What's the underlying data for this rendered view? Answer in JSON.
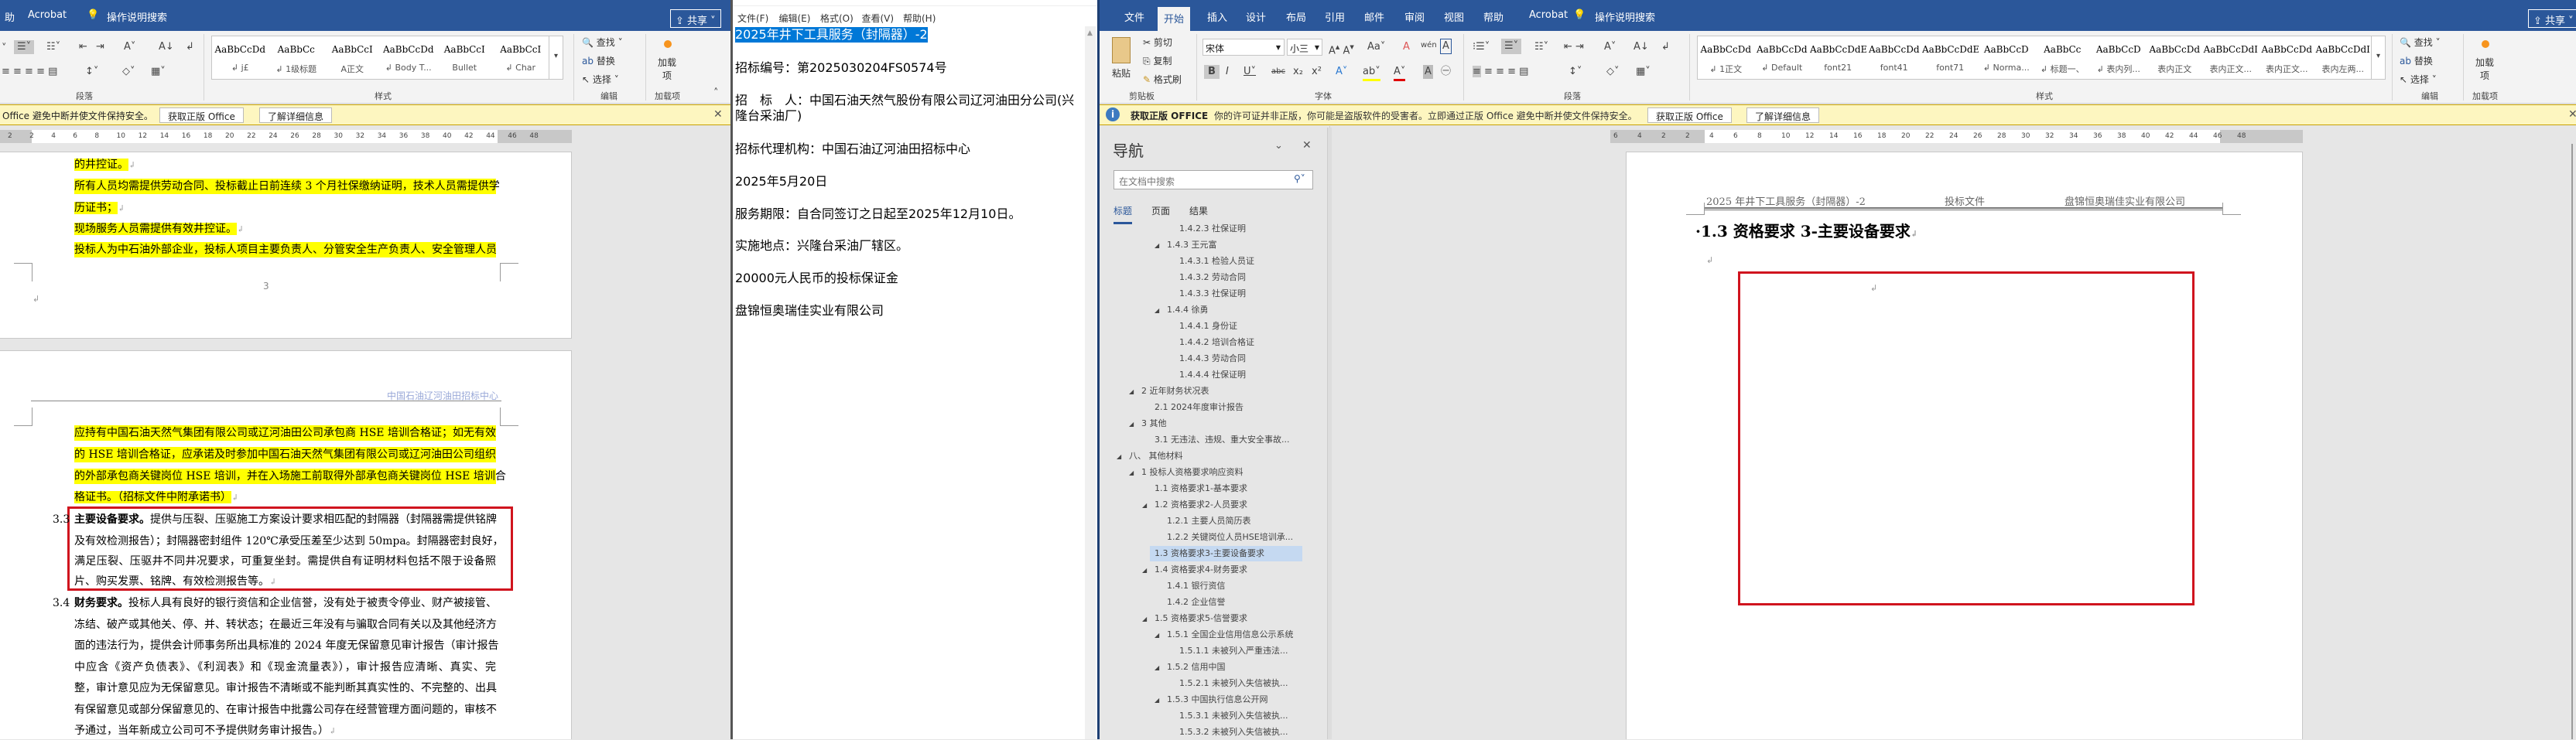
{
  "left_word": {
    "tabs": [
      "助",
      "Acrobat"
    ],
    "tell_me": "操作说明搜索",
    "share": "共享",
    "groups": {
      "paragraph": "段落",
      "styles": "样式",
      "editing": "编辑",
      "addins": "加载项"
    },
    "editing": {
      "find": "查找",
      "replace": "替换",
      "select": "选择"
    },
    "addins_button": "加载项",
    "styles": [
      {
        "preview": "AaBbCcDd",
        "name": "↲ j£"
      },
      {
        "preview": "AaBbCc",
        "name": "↲ 1级标题"
      },
      {
        "preview": "AaBbCcI",
        "name": "A正文"
      },
      {
        "preview": "AaBbCcDd",
        "name": "↲ Body T..."
      },
      {
        "preview": "AaBbCcI",
        "name": "Bullet"
      },
      {
        "preview": "AaBbCcI",
        "name": "↲ Char"
      }
    ],
    "message": "Office 避免中断并使文件保持安全。",
    "msg_btn_genuine": "获取正版 Office",
    "msg_btn_learn": "了解详细信息",
    "ruler_ticks": [
      "2",
      "2",
      "4",
      "6",
      "8",
      "10",
      "12",
      "14",
      "16",
      "18",
      "20",
      "22",
      "24",
      "26",
      "28",
      "30",
      "32",
      "34",
      "36",
      "38",
      "40",
      "42",
      "44",
      "46",
      "48"
    ],
    "page1_lines": [
      "的井控证。",
      "所有人员均需提供劳动合同、投标截止日前连续 3 个月社保缴纳证明，技术人员需提供学",
      "历证书；",
      "现场服务人员需提供有效井控证。",
      "投标人为中石油外部企业，投标人项目主要负责人、分管安全生产负责人、安全管理人员"
    ],
    "page_number": "3",
    "page2_header": "中国石油辽河油田招标中心",
    "page2_hl_lines": [
      "应持有中国石油天然气集团有限公司或辽河油田公司承包商 HSE 培训合格证；如无有效",
      "的 HSE 培训合格证，应承诺及时参加中国石油天然气集团有限公司或辽河油田公司组织",
      "的外部承包商关键岗位 HSE 培训，并在入场施工前取得外部承包商关键岗位 HSE 培训合",
      "格证书。（招标文件中附承诺书）"
    ],
    "item_33": {
      "number": "3.3",
      "title": "主要设备要求。",
      "lines": [
        "提供与压裂、压驱施工方案设计要求相匹配的封隔器（封隔器需提供铭牌",
        "及有效检测报告）；封隔器密封组件 120℃承受压差至少达到 50mpa。封隔器密封良好，",
        "满足压裂、压驱井不同井况要求，可重复坐封。需提供自有证明材料包括不限于设备照",
        "片、购买发票、铭牌、有效检测报告等。"
      ]
    },
    "item_34": {
      "number": "3.4",
      "title": "财务要求。",
      "lines": [
        "投标人具有良好的银行资信和企业信誉，没有处于被责令停业、财产被接管、",
        "冻结、破产或其他关、停、并、转状态；在最近三年没有与骗取合同有关以及其他经济方",
        "面的违法行为，提供会计师事务所出具标准的 2024 年度无保留意见审计报告（审计报告",
        "中应含《资产负债表》、《利润表》和《现金流量表》），审计报告应清晰、真实、完",
        "整，审计意见应为无保留意见。审计报告不清晰或不能判断其真实性的、不完整的、出具",
        "有保留意见或部分保留意见的、在审计报告中批露公司存在经营管理方面问题的，审核不",
        "予通过，当年新成立公司可不予提供财务审计报告。）"
      ]
    }
  },
  "notepad": {
    "menu": [
      "文件(F)",
      "编辑(E)",
      "格式(O)",
      "查看(V)",
      "帮助(H)"
    ],
    "lines": [
      "2025年井下工具服务（封隔器）-2",
      "招标编号：第2025030204FS0574号",
      "招　标　人：中国石油天然气股份有限公司辽河油田分公司(兴",
      "隆台采油厂)",
      "招标代理机构：中国石油辽河油田招标中心",
      "2025年5月20日",
      "服务期限：自合同签订之日起至2025年12月10日。",
      "实施地点：兴隆台采油厂辖区。",
      "20000元人民币的投标保证金",
      "盘锦恒奥瑞佳实业有限公司"
    ]
  },
  "right_word": {
    "tabs": [
      "文件",
      "开始",
      "插入",
      "设计",
      "布局",
      "引用",
      "邮件",
      "审阅",
      "视图",
      "帮助",
      "Acrobat"
    ],
    "active_tab": "开始",
    "tell_me": "操作说明搜索",
    "share": "共享",
    "clipboard": {
      "paste": "粘贴",
      "cut": "剪切",
      "copy": "复制",
      "format_painter": "格式刷"
    },
    "font_name": "宋体",
    "font_size": "小三",
    "groups": {
      "clipboard": "剪贴板",
      "font": "字体",
      "paragraph": "段落",
      "styles": "样式",
      "editing": "编辑",
      "addins": "加载项"
    },
    "editing": {
      "find": "查找",
      "replace": "替换",
      "select": "选择"
    },
    "addins_button": "加载项",
    "styles": [
      {
        "preview": "AaBbCcDd",
        "name": "↲ 1正文"
      },
      {
        "preview": "AaBbCcDd",
        "name": "↲ Default"
      },
      {
        "preview": "AaBbCcDdE",
        "name": "font21"
      },
      {
        "preview": "AaBbCcDd",
        "name": "font41"
      },
      {
        "preview": "AaBbCcDdEe",
        "name": "font71"
      },
      {
        "preview": "AaBbCcD",
        "name": "↲ Norma..."
      },
      {
        "preview": "AaBbCc",
        "name": "↲ 标题一、"
      },
      {
        "preview": "AaBbCcD",
        "name": "↲ 表内列..."
      },
      {
        "preview": "AaBbCcDd",
        "name": "表内正文"
      },
      {
        "preview": "AaBbCcDdI",
        "name": "表内正文..."
      },
      {
        "preview": "AaBbCcDd",
        "name": "表内正文..."
      },
      {
        "preview": "AaBbCcDdI",
        "name": "表内左两..."
      }
    ],
    "message_title": "获取正版 OFFICE",
    "message": "你的许可证并非正版，你可能是盗版软件的受害者。立即通过正版 Office 避免中断并使文件保持安全。",
    "msg_btn_genuine": "获取正版 Office",
    "msg_btn_learn": "了解详细信息",
    "nav": {
      "title": "导航",
      "search_placeholder": "在文档中搜索",
      "tabs": [
        "标题",
        "页面",
        "结果"
      ],
      "items": [
        {
          "label": "1.4.2.3 社保证明",
          "level": 3
        },
        {
          "label": "1.4.3 王元富",
          "level": 2,
          "expanded": true
        },
        {
          "label": "1.4.3.1 检验人员证",
          "level": 3
        },
        {
          "label": "1.4.3.2 劳动合同",
          "level": 3
        },
        {
          "label": "1.4.3.3 社保证明",
          "level": 3
        },
        {
          "label": "1.4.4 徐勇",
          "level": 2,
          "expanded": true
        },
        {
          "label": "1.4.4.1 身份证",
          "level": 3
        },
        {
          "label": "1.4.4.2 培训合格证",
          "level": 3
        },
        {
          "label": "1.4.4.3 劳动合同",
          "level": 3
        },
        {
          "label": "1.4.4.4 社保证明",
          "level": 3
        },
        {
          "label": "2 近年财务状况表",
          "level": 0,
          "expanded": true
        },
        {
          "label": "2.1 2024年度审计报告",
          "level": 1
        },
        {
          "label": "3 其他",
          "level": 0,
          "expanded": true
        },
        {
          "label": "3.1 无违法、违规、重大安全事故...",
          "level": 1
        },
        {
          "label": "八、 其他材料",
          "level": -1,
          "expanded": true
        },
        {
          "label": "1 投标人资格要求响应资料",
          "level": 0,
          "expanded": true
        },
        {
          "label": "1.1 资格要求1-基本要求",
          "level": 1
        },
        {
          "label": "1.2 资格要求2-人员要求",
          "level": 1,
          "expanded": true
        },
        {
          "label": "1.2.1 主要人员简历表",
          "level": 2
        },
        {
          "label": "1.2.2 关键岗位人员HSE培训承...",
          "level": 2
        },
        {
          "label": "1.3 资格要求3-主要设备要求",
          "level": 1,
          "selected": true
        },
        {
          "label": "1.4 资格要求4-财务要求",
          "level": 1,
          "expanded": true
        },
        {
          "label": "1.4.1 银行资信",
          "level": 2
        },
        {
          "label": "1.4.2 企业信誉",
          "level": 2
        },
        {
          "label": "1.5 资格要求5-信誉要求",
          "level": 1,
          "expanded": true
        },
        {
          "label": "1.5.1 全国企业信用信息公示系统",
          "level": 2,
          "expanded": true
        },
        {
          "label": "1.5.1.1 未被列入严重违法...",
          "level": 3
        },
        {
          "label": "1.5.2 信用中国",
          "level": 2,
          "expanded": true
        },
        {
          "label": "1.5.2.1 未被列入失信被执...",
          "level": 3
        },
        {
          "label": "1.5.3 中国执行信息公开网",
          "level": 2,
          "expanded": true
        },
        {
          "label": "1.5.3.1 未被列入失信被执...",
          "level": 3
        },
        {
          "label": "1.5.3.2 未被列入失信被执...",
          "level": 3
        }
      ]
    },
    "ruler_ticks": [
      "6",
      "4",
      "2",
      "2",
      "4",
      "6",
      "8",
      "10",
      "12",
      "14",
      "16",
      "18",
      "20",
      "22",
      "24",
      "26",
      "28",
      "30",
      "32",
      "34",
      "36",
      "38",
      "40",
      "42",
      "44",
      "46",
      "48"
    ],
    "page_header": {
      "left": "2025 年井下工具服务（封隔器）-2",
      "center": "投标文件",
      "right": "盘锦恒奥瑞佳实业有限公司"
    },
    "heading": "1.3 资格要求 3-主要设备要求"
  },
  "colors": {
    "title_blue": "#2b579a",
    "highlight": "#ffff00",
    "red_box": "#d0141e",
    "selection": "#0078d7"
  }
}
